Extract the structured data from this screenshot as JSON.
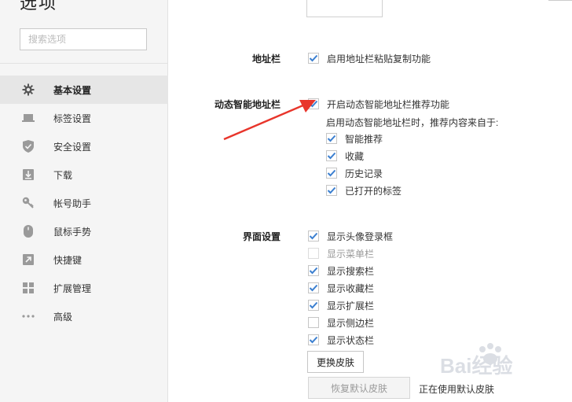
{
  "window": {
    "title": "选项"
  },
  "search": {
    "placeholder": "搜索选项"
  },
  "sidebar": {
    "items": [
      {
        "label": "基本设置",
        "icon": "gear-icon",
        "active": true
      },
      {
        "label": "标签设置",
        "icon": "tab-icon"
      },
      {
        "label": "安全设置",
        "icon": "shield-icon"
      },
      {
        "label": "下载",
        "icon": "download-icon"
      },
      {
        "label": "帐号助手",
        "icon": "key-icon"
      },
      {
        "label": "鼠标手势",
        "icon": "mouse-icon"
      },
      {
        "label": "快捷键",
        "icon": "shortcut-icon"
      },
      {
        "label": "扩展管理",
        "icon": "extension-icon"
      },
      {
        "label": "高级",
        "icon": "more-icon"
      }
    ]
  },
  "addressbar": {
    "label": "地址栏",
    "option": {
      "label": "启用地址栏粘贴复制功能",
      "checked": true
    }
  },
  "smart_addressbar": {
    "label": "动态智能地址栏",
    "option": {
      "label": "开启动态智能地址栏推荐功能",
      "checked": true
    },
    "hint": "启用动态智能地址栏时，推荐内容来自于:",
    "sources": [
      {
        "label": "智能推荐",
        "checked": true
      },
      {
        "label": "收藏",
        "checked": true
      },
      {
        "label": "历史记录",
        "checked": true
      },
      {
        "label": "已打开的标签",
        "checked": true
      }
    ]
  },
  "interface": {
    "label": "界面设置",
    "options": [
      {
        "label": "显示头像登录框",
        "checked": true
      },
      {
        "label": "显示菜单栏",
        "checked": false,
        "disabled": true
      },
      {
        "label": "显示搜索栏",
        "checked": true
      },
      {
        "label": "显示收藏栏",
        "checked": true
      },
      {
        "label": "显示扩展栏",
        "checked": true
      },
      {
        "label": "显示侧边栏",
        "checked": false
      },
      {
        "label": "显示状态栏",
        "checked": true
      }
    ],
    "change_skin_button": "更换皮肤",
    "restore_skin_button": "恢复默认皮肤",
    "skin_status": "正在使用默认皮肤"
  },
  "colors": {
    "accent": "#3b7fd0",
    "arrow": "#e8352b"
  },
  "watermark": "Bai经验"
}
